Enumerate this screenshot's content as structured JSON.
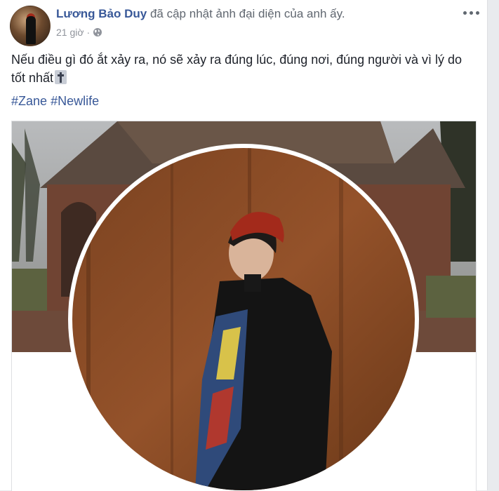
{
  "post": {
    "author": "Lương Bảo Duy",
    "action": "đã cập nhật ảnh đại diện của anh ấy.",
    "time": "21 giờ",
    "separator": "·",
    "privacy_icon": "globe-icon",
    "more_icon": "more-options-icon",
    "text": "Nếu điều gì đó ắt xảy ra, nó sẽ xảy ra đúng lúc, đúng nơi, đúng người và vì lý do tốt nhất",
    "text_emoji": "latin-cross-emoji",
    "hashtags": [
      "#Zane",
      "#Newlife"
    ]
  },
  "colors": {
    "link": "#385898",
    "meta": "#90949c",
    "roof": "#5a4a40",
    "brick": "#7a4a38",
    "rust": "#8a4a22",
    "hat": "#a32a1b"
  }
}
